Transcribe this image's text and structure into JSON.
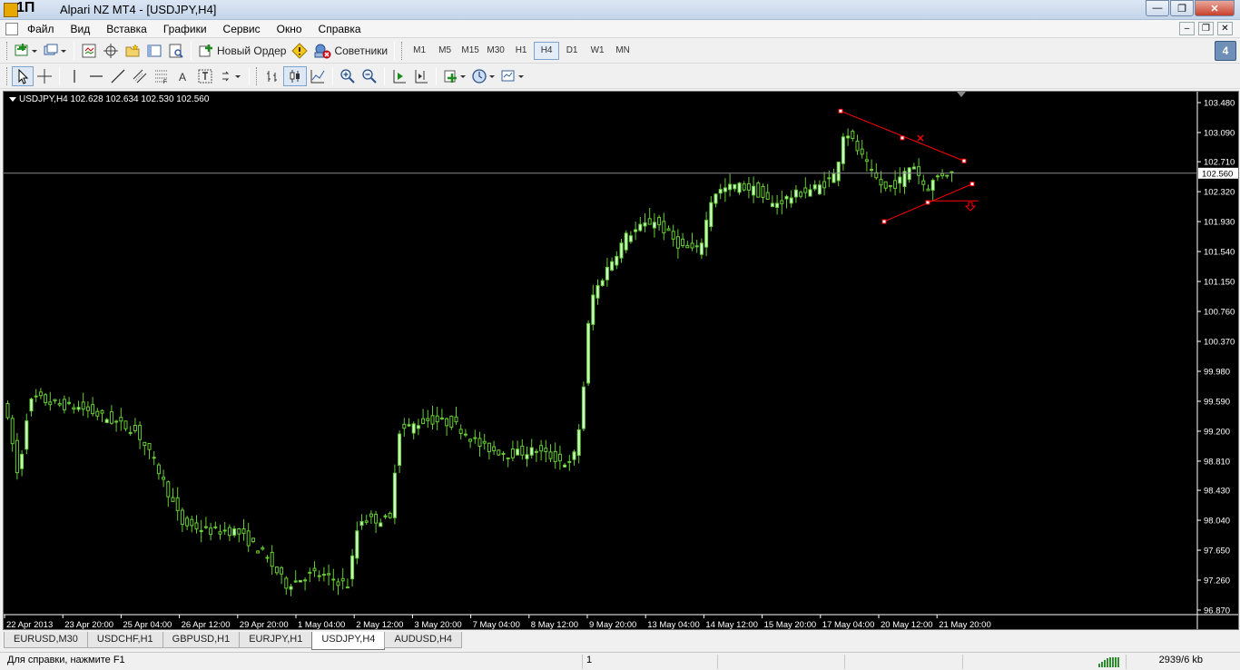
{
  "window": {
    "title": "Alpari NZ MT4 - [USDJPY,H4]",
    "logo_text": "1П",
    "minimize": "—",
    "maximize": "❐",
    "close": "✕"
  },
  "menu": {
    "items": [
      "Файл",
      "Вид",
      "Вставка",
      "Графики",
      "Сервис",
      "Окно",
      "Справка"
    ],
    "mdi_minimize": "–",
    "mdi_restore": "❐",
    "mdi_close": "✕"
  },
  "toolbar1": {
    "new_order": "Новый Ордер",
    "experts": "Советники",
    "timeframes": [
      "M1",
      "M5",
      "M15",
      "M30",
      "H1",
      "H4",
      "D1",
      "W1",
      "MN"
    ],
    "active_timeframe": "H4",
    "notification": "4"
  },
  "chart": {
    "info": "USDJPY,H4  102.628 102.634 102.530 102.560",
    "current_price": "102.560",
    "price_labels": [
      "103.480",
      "103.090",
      "102.710",
      "102.320",
      "101.930",
      "101.540",
      "101.150",
      "100.760",
      "100.370",
      "99.980",
      "99.590",
      "99.200",
      "98.810",
      "98.430",
      "98.040",
      "97.650",
      "97.260",
      "96.870"
    ],
    "time_labels": [
      "22 Apr 2013",
      "23 Apr 20:00",
      "25 Apr 04:00",
      "26 Apr 12:00",
      "29 Apr 20:00",
      "1 May 04:00",
      "2 May 12:00",
      "3 May 20:00",
      "7 May 04:00",
      "8 May 12:00",
      "9 May 20:00",
      "13 May 04:00",
      "14 May 12:00",
      "15 May 20:00",
      "17 May 04:00",
      "20 May 12:00",
      "21 May 20:00"
    ],
    "colors": {
      "background": "#000000",
      "bull": "#ccffcc",
      "wick": "#66cc33",
      "trendline": "#ff0000",
      "bid_line": "#8a8a8a"
    }
  },
  "tabs": {
    "items": [
      "EURUSD,M30",
      "USDCHF,H1",
      "GBPUSD,H1",
      "EURJPY,H1",
      "USDJPY,H4",
      "AUDUSD,H4"
    ],
    "active": "USDJPY,H4"
  },
  "status": {
    "help": "Для справки, нажмите F1",
    "profile": "1",
    "traffic": "2939/6 kb"
  }
}
